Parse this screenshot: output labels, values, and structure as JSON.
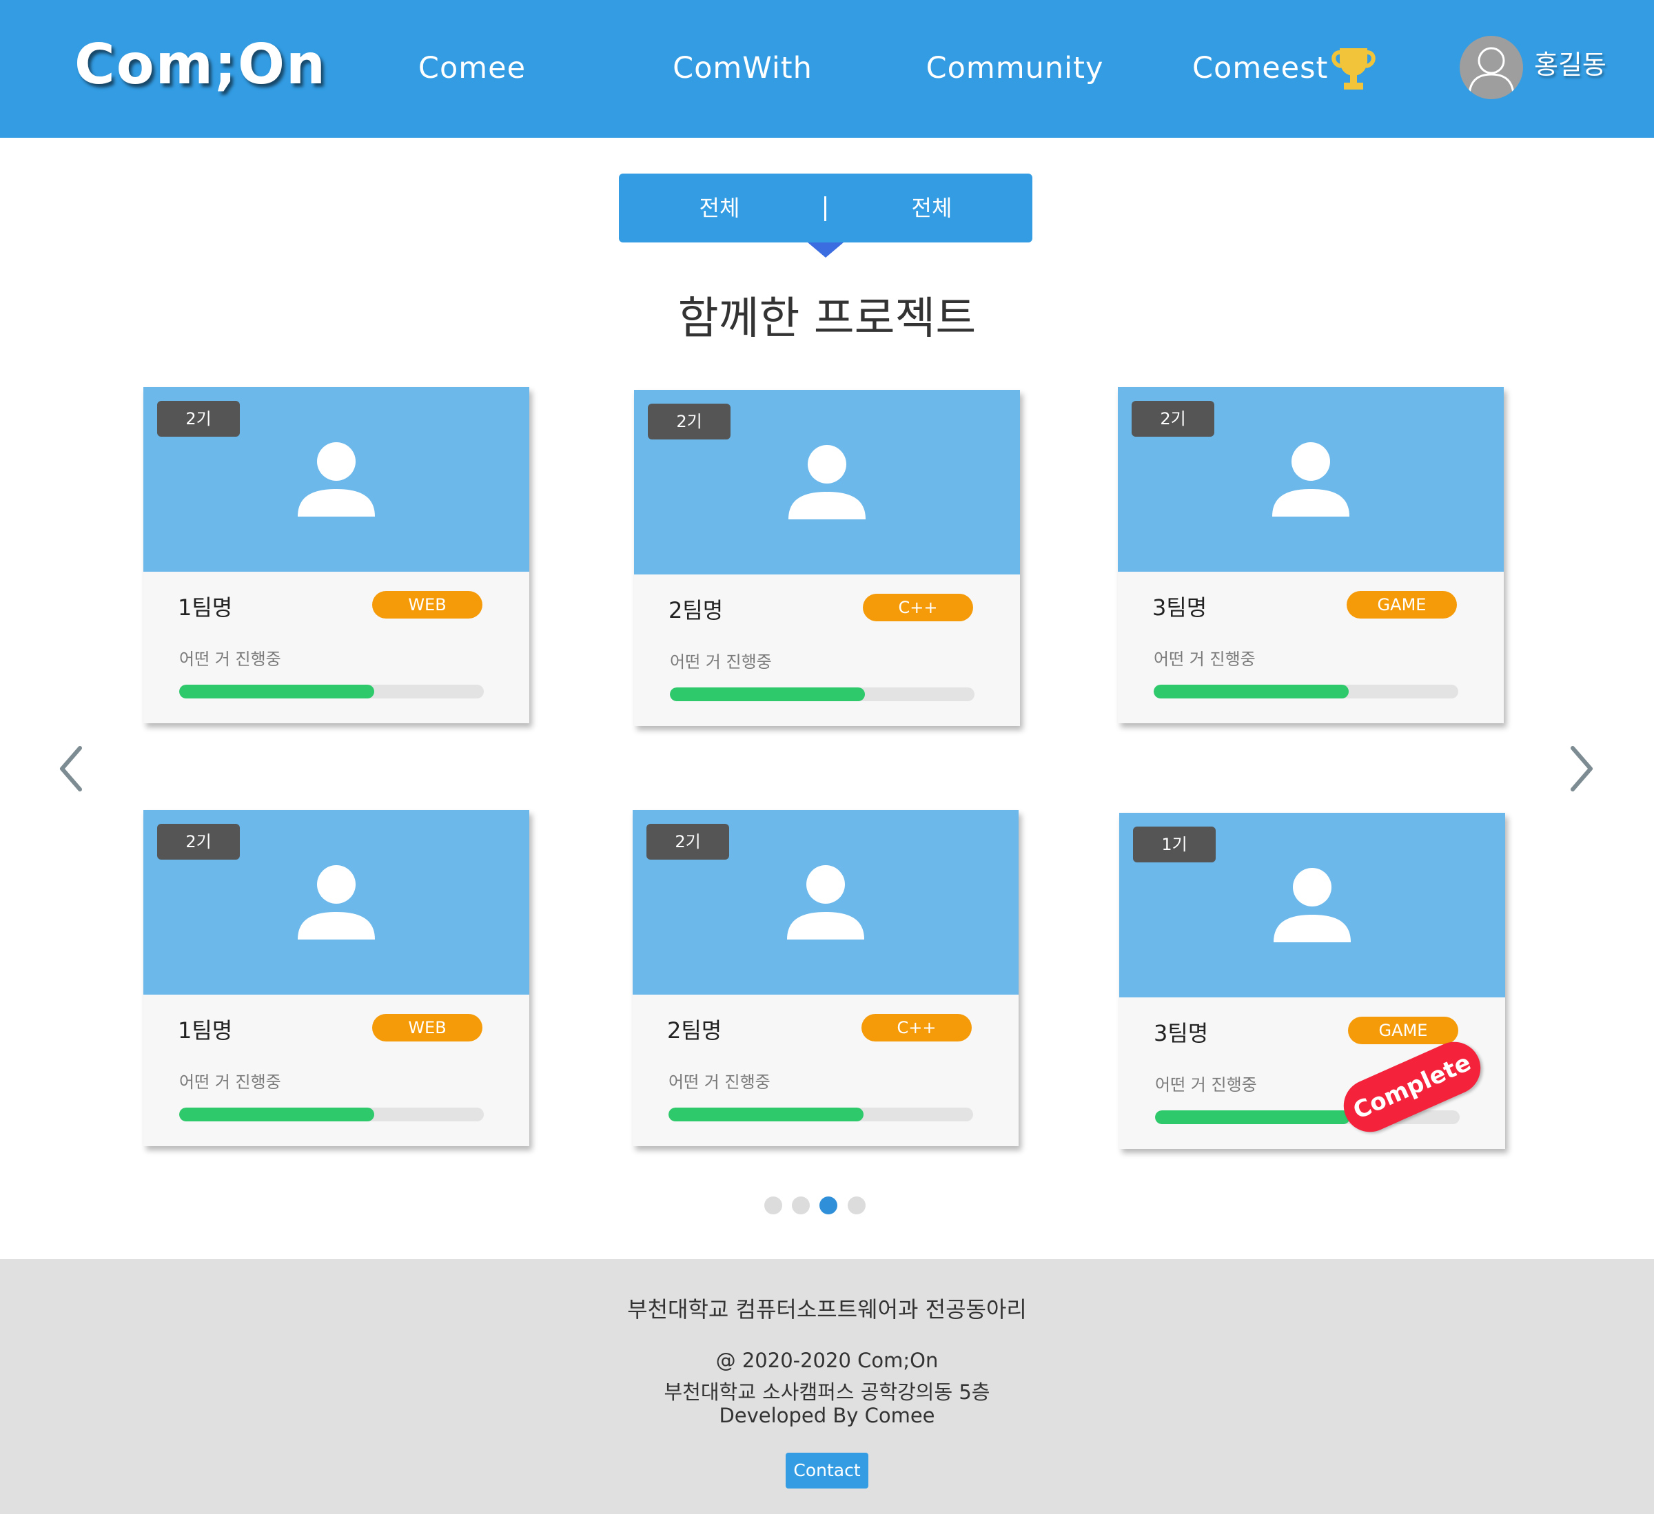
{
  "header": {
    "logo": "Com;On",
    "nav": [
      "Comee",
      "ComWith",
      "Community",
      "Comeest"
    ],
    "user_name": "홍길동"
  },
  "filter": {
    "option_1": "전체",
    "option_2": "전체"
  },
  "section_title": "함께한 프로젝트",
  "cards": [
    {
      "generation": "2기",
      "team": "1팀명",
      "tag": "WEB",
      "status": "어떤 거 진행중",
      "progress": 0.64,
      "complete": false
    },
    {
      "generation": "2기",
      "team": "2팀명",
      "tag": "C++",
      "status": "어떤 거 진행중",
      "progress": 0.64,
      "complete": false
    },
    {
      "generation": "2기",
      "team": "3팀명",
      "tag": "GAME",
      "status": "어떤 거 진행중",
      "progress": 0.64,
      "complete": false
    },
    {
      "generation": "2기",
      "team": "1팀명",
      "tag": "WEB",
      "status": "어떤 거 진행중",
      "progress": 0.64,
      "complete": false
    },
    {
      "generation": "2기",
      "team": "2팀명",
      "tag": "C++",
      "status": "어떤 거 진행중",
      "progress": 0.64,
      "complete": false
    },
    {
      "generation": "1기",
      "team": "3팀명",
      "tag": "GAME",
      "status": "어떤 거 진행중",
      "progress": 0.64,
      "complete": true,
      "stamp": "Complete"
    }
  ],
  "pagination": {
    "pages": 4,
    "active": 3
  },
  "footer": {
    "club": "부천대학교 컴퓨터소프트웨어과 전공동아리",
    "copyright": "@ 2020-2020 Com;On",
    "address": "부천대학교 소사캠퍼스 공학강의동 5층",
    "developer": "Developed By Comee",
    "contact": "Contact"
  },
  "colors": {
    "primary": "#339ce3",
    "card_top": "#6cb8eb",
    "tag": "#f59b0a",
    "progress": "#2ec96a",
    "stamp": "#f4223a",
    "trophy": "#f2c43a"
  }
}
